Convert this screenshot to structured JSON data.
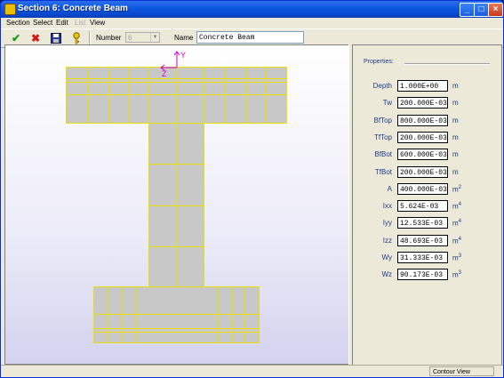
{
  "window": {
    "title": "Section 6: Concrete Beam"
  },
  "menu": [
    {
      "label": "Section",
      "enabled": true
    },
    {
      "label": "Select",
      "enabled": true
    },
    {
      "label": "Edit",
      "enabled": true
    },
    {
      "label": "List",
      "enabled": false
    },
    {
      "label": "View",
      "enabled": true
    }
  ],
  "toolbar": {
    "number_label": "Number",
    "number_value": "6",
    "name_label": "Name",
    "name_value": "Concrete Beam"
  },
  "canvas": {
    "axis_y": "Y",
    "axis_z": "Z"
  },
  "properties": {
    "title": "Properties:",
    "rows": [
      {
        "label": "Depth",
        "value": "1.000E+00",
        "unit": "m",
        "exp": ""
      },
      {
        "label": "Tw",
        "value": "200.000E-03",
        "unit": "m",
        "exp": ""
      },
      {
        "label": "BfTop",
        "value": "800.000E-03",
        "unit": "m",
        "exp": ""
      },
      {
        "label": "TfTop",
        "value": "200.000E-03",
        "unit": "m",
        "exp": ""
      },
      {
        "label": "BfBot",
        "value": "600.000E-03",
        "unit": "m",
        "exp": ""
      },
      {
        "label": "TfBot",
        "value": "200.000E-03",
        "unit": "m",
        "exp": ""
      },
      {
        "label": "A",
        "value": "400.000E-03",
        "unit": "m",
        "exp": "2"
      },
      {
        "label": "Ixx",
        "value": "5.624E-03",
        "unit": "m",
        "exp": "4"
      },
      {
        "label": "Iyy",
        "value": "12.533E-03",
        "unit": "m",
        "exp": "4"
      },
      {
        "label": "Izz",
        "value": "48.693E-03",
        "unit": "m",
        "exp": "4"
      },
      {
        "label": "Wy",
        "value": "31.333E-03",
        "unit": "m",
        "exp": "3"
      },
      {
        "label": "Wz",
        "value": "90.173E-03",
        "unit": "m",
        "exp": "3"
      }
    ]
  },
  "status": {
    "view": "Contour View"
  },
  "colors": {
    "mesh_fill": "#c8c8c8",
    "mesh_line": "#e8e000",
    "axis": "#d000d0"
  }
}
